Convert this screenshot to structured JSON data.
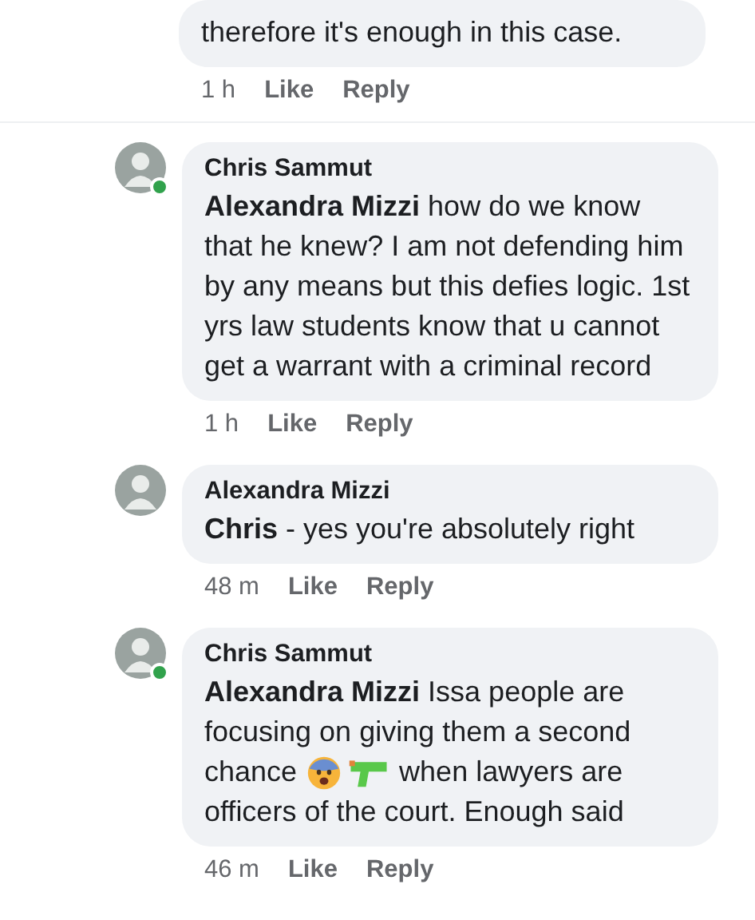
{
  "previous_comment": {
    "text": "therefore it's enough in this case.",
    "time": "1 h",
    "like": "Like",
    "reply": "Reply"
  },
  "comments": [
    {
      "author": "Chris Sammut",
      "online": true,
      "body": [
        {
          "parts": [
            {
              "kind": "text",
              "text": "**Alexandra Mizzi** how do we know that he knew? I am not defending him by any means but this defies logic. 1st yrs law students know that u cannot get a warrant with a criminal record"
            }
          ]
        }
      ],
      "time": "1 h",
      "like": "Like",
      "reply": "Reply"
    },
    {
      "author": "Alexandra Mizzi",
      "online": false,
      "body": [
        {
          "parts": [
            {
              "kind": "text",
              "text": "**Chris** - yes you're absolutely right"
            }
          ]
        }
      ],
      "time": "48 m",
      "like": "Like",
      "reply": "Reply"
    },
    {
      "author": "Chris Sammut",
      "online": true,
      "body": [
        {
          "parts": [
            {
              "kind": "text",
              "text": "**Alexandra Mizzi** Issa people are focusing on giving them a second"
            }
          ]
        },
        {
          "parts": [
            {
              "kind": "text",
              "text": "chance"
            },
            {
              "kind": "fearful-face"
            },
            {
              "kind": "water-pistol"
            },
            {
              "kind": "text",
              "text": "when lawyers are"
            }
          ]
        },
        {
          "parts": [
            {
              "kind": "text",
              "text": "officers of the court. Enough said"
            }
          ]
        }
      ],
      "time": "46 m",
      "like": "Like",
      "reply": "Reply"
    }
  ]
}
